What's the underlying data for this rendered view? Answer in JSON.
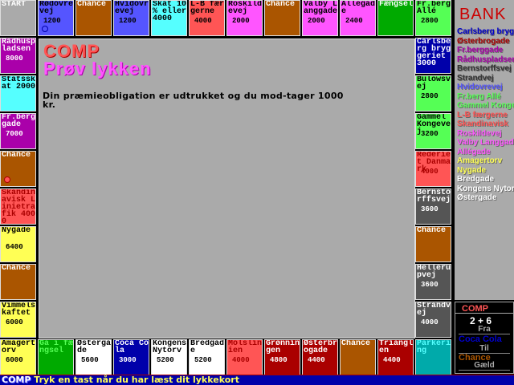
{
  "board": {
    "top": [
      {
        "label": "START",
        "bg": "#aaaaaa",
        "fg": "#ffffff"
      },
      {
        "label": "Rødovrevej",
        "price": "1200",
        "bg": "#5555ff",
        "fg": "#000000",
        "token": "#0000aa"
      },
      {
        "label": "Chance",
        "bg": "#aa5500",
        "fg": "#ffffff"
      },
      {
        "label": "Hvidovrevej",
        "price": "1200",
        "bg": "#5555ff",
        "fg": "#000000"
      },
      {
        "label": "Skat 10 % eller 4000",
        "bg": "#55ffff",
        "fg": "#000000"
      },
      {
        "label": "L-B færgerne",
        "price": "4000",
        "bg": "#ff5555",
        "fg": "#000000"
      },
      {
        "label": "Roskildevej",
        "price": "2000",
        "bg": "#ff55ff",
        "fg": "#000000"
      },
      {
        "label": "Chance",
        "bg": "#aa5500",
        "fg": "#ffffff"
      },
      {
        "label": "Valby Langgade",
        "price": "2000",
        "bg": "#ff55ff",
        "fg": "#000000"
      },
      {
        "label": "Allégade",
        "price": "2400",
        "bg": "#ff55ff",
        "fg": "#000000"
      },
      {
        "label": "Fængsel",
        "bg": "#00aa00",
        "fg": "#ffffff"
      },
      {
        "label": "Fr.berg Allé",
        "price": "2800",
        "bg": "#55ff55",
        "fg": "#000000"
      }
    ],
    "right": [
      {
        "label": "Carlsberg bryggeriet 3000",
        "bg": "#0000aa",
        "fg": "#ffffff"
      },
      {
        "label": "Bülowsvej",
        "price": "2800",
        "bg": "#55ff55",
        "fg": "#000000"
      },
      {
        "label": "Gammel Kongevej",
        "price": "3200",
        "bg": "#55ff55",
        "fg": "#000000"
      },
      {
        "label": "Rederiet Danmark",
        "price": "4000",
        "bg": "#ff5555",
        "fg": "#aa0000"
      },
      {
        "label": "Bernstorffsvej",
        "price": "3600",
        "bg": "#555555",
        "fg": "#ffffff"
      },
      {
        "label": "Chance",
        "bg": "#aa5500",
        "fg": "#ffffff"
      },
      {
        "label": "Hellerupvej",
        "price": "3600",
        "bg": "#555555",
        "fg": "#ffffff"
      },
      {
        "label": "Strandvej",
        "price": "4000",
        "bg": "#555555",
        "fg": "#ffffff"
      },
      {
        "label": "Parkering",
        "bg": "#00aaaa",
        "fg": "#55ffff"
      }
    ],
    "bottom": [
      {
        "label": "Gå i fængsel",
        "bg": "#00aa00",
        "fg": "#55ff55"
      },
      {
        "label": "Østergade",
        "price": "5600",
        "bg": "#ffffff",
        "fg": "#000000"
      },
      {
        "label": "Coca Cola",
        "price": "3000",
        "bg": "#0000aa",
        "fg": "#ffffff"
      },
      {
        "label": "Kongens Nytorv",
        "price": "5200",
        "bg": "#ffffff",
        "fg": "#000000"
      },
      {
        "label": "Bredgade",
        "price": "5200",
        "bg": "#ffffff",
        "fg": "#000000"
      },
      {
        "label": "Molslinien",
        "price": "4000",
        "bg": "#ff5555",
        "fg": "#aa0000"
      },
      {
        "label": "Grønningen",
        "price": "4800",
        "bg": "#aa0000",
        "fg": "#ffffff"
      },
      {
        "label": "Østerbrogade",
        "price": "4400",
        "bg": "#aa0000",
        "fg": "#ffffff"
      },
      {
        "label": "Chance",
        "bg": "#aa5500",
        "fg": "#ffffff"
      },
      {
        "label": "Trianglen",
        "price": "4400",
        "bg": "#aa0000",
        "fg": "#ffffff"
      },
      {
        "label": "Parkering",
        "bg": "#00aaaa",
        "fg": "#55ffff"
      }
    ],
    "left": [
      {
        "label": "Rådhuspladsen",
        "price": "8000",
        "bg": "#aa00aa",
        "fg": "#ffffff"
      },
      {
        "label": "Statsskat 2000",
        "bg": "#55ffff",
        "fg": "#000000"
      },
      {
        "label": "Fr.berggade",
        "price": "7000",
        "bg": "#aa00aa",
        "fg": "#ffffff"
      },
      {
        "label": "Chance",
        "bg": "#aa5500",
        "fg": "#ffffff",
        "token": "#aa0000",
        "token_fill": "#ff5555"
      },
      {
        "label": "Skandinavisk Linietrafik 4000",
        "bg": "#ff5555",
        "fg": "#aa0000"
      },
      {
        "label": "Nygade",
        "price": "6400",
        "bg": "#ffff55",
        "fg": "#000000"
      },
      {
        "label": "Chance",
        "bg": "#aa5500",
        "fg": "#ffffff"
      },
      {
        "label": "Vimmelskaftet",
        "price": "6000",
        "bg": "#ffff55",
        "fg": "#000000"
      },
      {
        "label": "Amagertorv",
        "price": "6000",
        "bg": "#ffff55",
        "fg": "#000000"
      }
    ]
  },
  "card": {
    "owner": "COMP",
    "title": "Prøv lykken",
    "text": "Din præmieobligation er udtrukket og du mod-tager 1000 kr."
  },
  "bank": {
    "title": "BANK",
    "items": [
      {
        "name": "Carlsberg bryggeriet",
        "color": "#0000cc"
      },
      {
        "name": "Østerbrogade",
        "color": "#aa0000"
      },
      {
        "name": "Fr.berggade",
        "color": "#aa00aa"
      },
      {
        "name": "Rådhuspladsen",
        "color": "#aa00aa"
      },
      {
        "name": "Bernstorffsvej",
        "color": "#333333"
      },
      {
        "name": "Strandvej",
        "color": "#333333"
      },
      {
        "name": "Hvidovrevej",
        "color": "#5555ff"
      },
      {
        "name": "Fr.berg Allé",
        "color": "#55ff55"
      },
      {
        "name": "Gammel Kongevej",
        "color": "#55ff55"
      },
      {
        "name": "L-B færgerne",
        "color": "#ff5555"
      },
      {
        "name": "Skandinavisk",
        "color": "#ff5555"
      },
      {
        "name": "Roskildevej",
        "color": "#ff55ff"
      },
      {
        "name": "Valby Langgade",
        "color": "#ff55ff"
      },
      {
        "name": "Allégade",
        "color": "#ff55ff"
      },
      {
        "name": "Amagertorv",
        "color": "#ffff55"
      },
      {
        "name": "Nygade",
        "color": "#ffff55"
      },
      {
        "name": "Bredgade",
        "color": "#ffffff"
      },
      {
        "name": "Kongens Nytorv",
        "color": "#ffffff"
      },
      {
        "name": "Østergade",
        "color": "#ffffff"
      }
    ]
  },
  "player": {
    "name": "COMP",
    "dice": "2 + 6",
    "from_label": "Fra",
    "from": "Coca Cola",
    "to_label": "Til",
    "to": "Chance",
    "debt_label": "Gæld"
  },
  "status": {
    "player": "COMP",
    "message": "Tryk en tast når du har læst dit lykkekort"
  }
}
